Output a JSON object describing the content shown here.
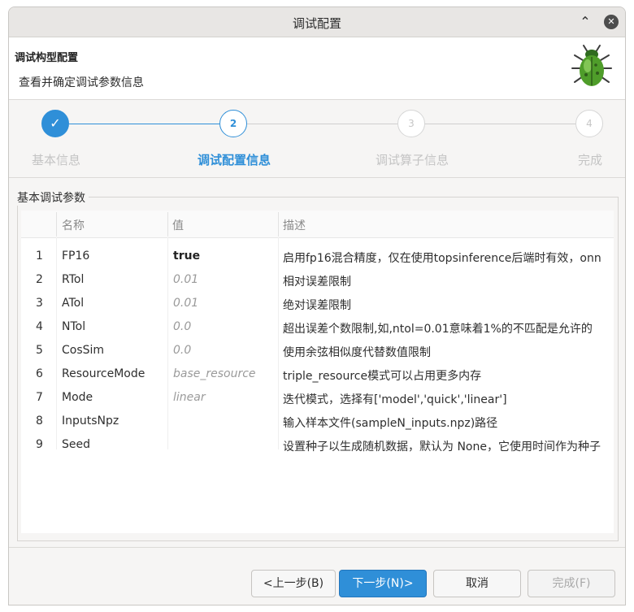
{
  "window": {
    "title": "调试配置",
    "minimize_glyph": "⌃",
    "close_glyph": "✕"
  },
  "header": {
    "title": "调试构型配置",
    "subtitle": "查看并确定调试参数信息",
    "logo_icon": "bug-icon"
  },
  "steps": [
    {
      "number": "1",
      "label": "基本信息",
      "state": "done",
      "glyph": "✓"
    },
    {
      "number": "2",
      "label": "调试配置信息",
      "state": "active"
    },
    {
      "number": "3",
      "label": "调试算子信息",
      "state": "todo"
    },
    {
      "number": "4",
      "label": "完成",
      "state": "todo"
    }
  ],
  "group": {
    "title": "基本调试参数"
  },
  "table": {
    "columns": [
      "名称",
      "值",
      "描述"
    ],
    "rows": [
      {
        "index": "1",
        "name": "FP16",
        "value": "true",
        "desc": "启用fp16混合精度，仅在使用topsinference后端时有效，onn"
      },
      {
        "index": "2",
        "name": "RTol",
        "value": "0.01",
        "desc": "相对误差限制"
      },
      {
        "index": "3",
        "name": "ATol",
        "value": "0.01",
        "desc": "绝对误差限制"
      },
      {
        "index": "4",
        "name": "NTol",
        "value": "0.0",
        "desc": "超出误差个数限制,如,ntol=0.01意味着1%的不匹配是允许的"
      },
      {
        "index": "5",
        "name": "CosSim",
        "value": "0.0",
        "desc": "使用余弦相似度代替数值限制"
      },
      {
        "index": "6",
        "name": "ResourceMode",
        "value": "base_resource",
        "desc": "triple_resource模式可以占用更多内存"
      },
      {
        "index": "7",
        "name": "Mode",
        "value": "linear",
        "desc": "迭代模式，选择有['model','quick','linear']"
      },
      {
        "index": "8",
        "name": "InputsNpz",
        "value": "",
        "desc": "输入样本文件(sampleN_inputs.npz)路径"
      },
      {
        "index": "9",
        "name": "Seed",
        "value": "",
        "desc": "设置种子以生成随机数据，默认为 None，它使用时间作为种子"
      }
    ]
  },
  "buttons": {
    "back": "<上一步(B)",
    "next": "下一步(N)>",
    "cancel": "取消",
    "finish": "完成(F)"
  },
  "colors": {
    "accent": "#2f8fd8",
    "inactive": "#c4c4c4"
  }
}
